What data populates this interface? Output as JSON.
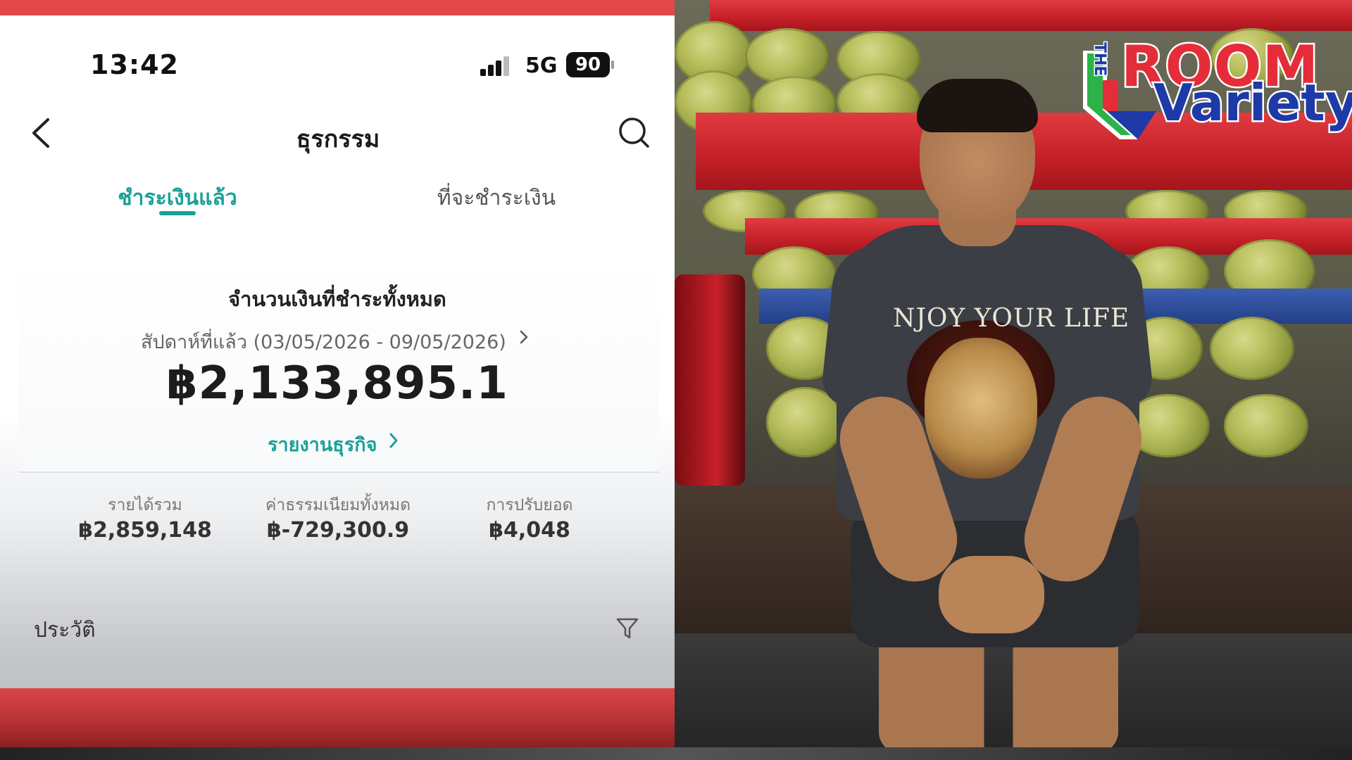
{
  "status_bar": {
    "time": "13:42",
    "network": "5G",
    "battery": "90"
  },
  "nav": {
    "title": "ธุรกรรม",
    "back_icon": "chevron-left-icon",
    "search_icon": "search-icon"
  },
  "tabs": [
    {
      "label": "ชำระเงินแล้ว",
      "active": true
    },
    {
      "label": "ที่จะชำระเงิน",
      "active": false
    }
  ],
  "summary": {
    "title": "จำนวนเงินที่ชำระทั้งหมด",
    "period": "สัปดาห์ที่แล้ว (03/05/2026 - 09/05/2026)",
    "total": "฿2,133,895.1",
    "report_link": "รายงานธุรกิจ"
  },
  "stats": [
    {
      "label": "รายได้รวม",
      "value": "฿2,859,148"
    },
    {
      "label": "ค่าธรรมเนียมทั้งหมด",
      "value": "฿-729,300.9"
    },
    {
      "label": "การปรับยอด",
      "value": "฿4,048"
    }
  ],
  "history": {
    "label": "ประวัติ",
    "filter_icon": "filter-icon"
  },
  "photo": {
    "shirt_text": "NJOY YOUR LIFE"
  },
  "logo": {
    "the": "THE",
    "room": "ROOM",
    "variety": "Variety"
  },
  "colors": {
    "accent": "#1aa098",
    "banner_red": "#e5484a",
    "logo_red": "#e52d3a",
    "logo_blue": "#1d3aa8"
  }
}
